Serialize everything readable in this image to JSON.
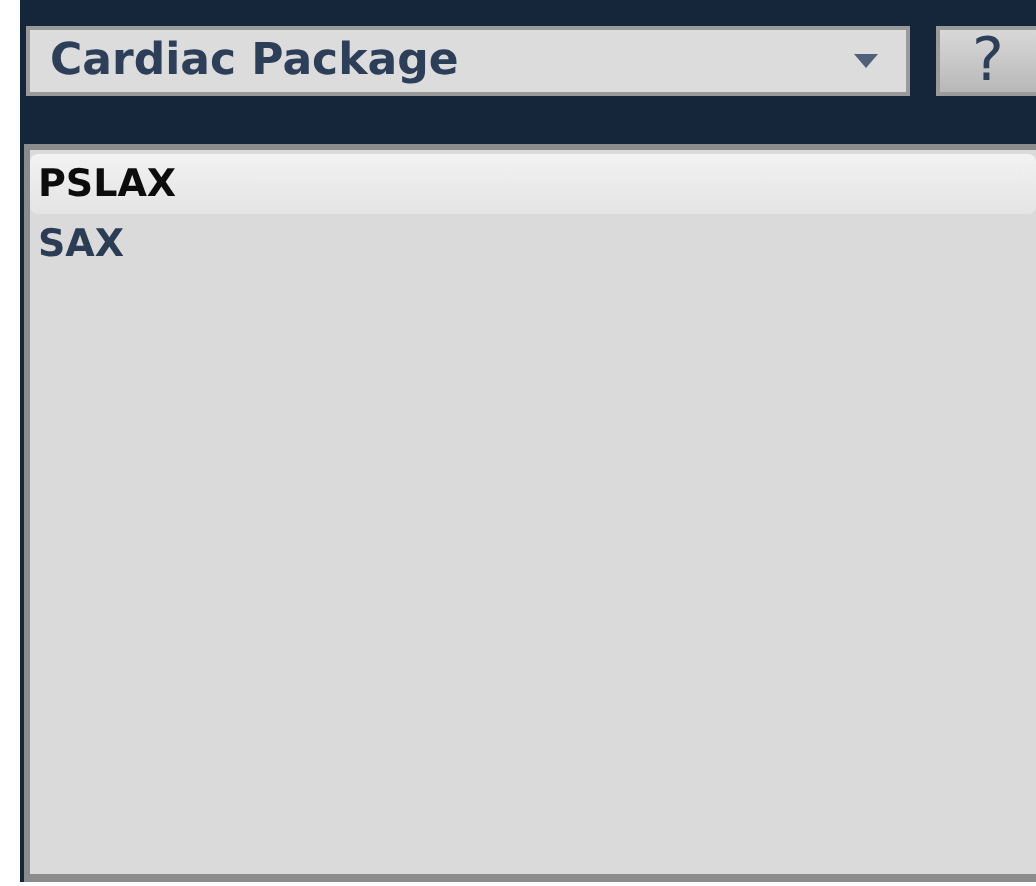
{
  "package_select": {
    "value": "Cardiac Package"
  },
  "help_button": {
    "label": "?"
  },
  "views": [
    {
      "label": "PSLAX",
      "selected": true
    },
    {
      "label": "SAX",
      "selected": false
    }
  ]
}
